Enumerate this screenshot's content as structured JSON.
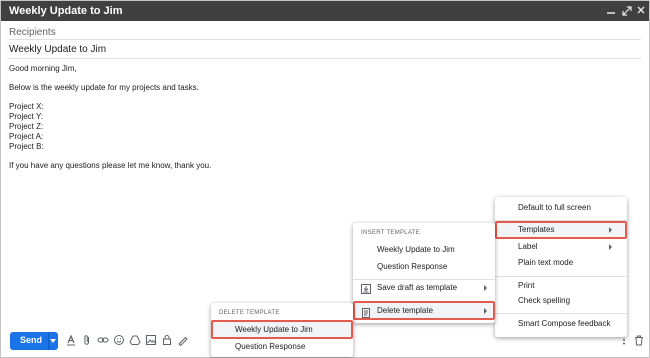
{
  "window": {
    "title": "Weekly Update to Jim",
    "controls": [
      "minimize-icon",
      "expand-icon",
      "close-icon"
    ]
  },
  "compose": {
    "recipients_placeholder": "Recipients",
    "subject": "Weekly Update to Jim",
    "body_lines": [
      "Good morning Jim,",
      "Below is the weekly update for my projects and tasks.",
      "Project X:",
      "Project Y:",
      "Project Z:",
      "Project A:",
      "Project B:",
      "If you have any questions please let me know, thank you."
    ]
  },
  "toolbar": {
    "send_label": "Send",
    "icons": [
      "formatting-icon",
      "attach-icon",
      "link-icon",
      "emoji-icon",
      "drive-icon",
      "photo-icon",
      "confidential-icon",
      "signature-icon"
    ],
    "right_icons": [
      "more-options-icon",
      "trash-icon"
    ]
  },
  "more_menu": {
    "items": [
      {
        "label": "Default to full screen"
      },
      {
        "label": "Templates",
        "has_submenu": true,
        "highlighted": true
      },
      {
        "label": "Label",
        "has_submenu": true
      },
      {
        "label": "Plain text mode"
      },
      {
        "label": "Print"
      },
      {
        "label": "Check spelling"
      },
      {
        "label": "Smart Compose feedback"
      }
    ]
  },
  "templates_menu": {
    "insert_header": "INSERT TEMPLATE",
    "insert_items": [
      "Weekly Update to Jim",
      "Question Response"
    ],
    "save_label": "Save draft as template",
    "delete_label": "Delete template"
  },
  "delete_menu": {
    "header": "DELETE TEMPLATE",
    "items": [
      "Weekly Update to Jim",
      "Question Response"
    ]
  },
  "colors": {
    "titlebar": "#404040",
    "send": "#1a73e8",
    "highlight_border": "#e35a4f"
  }
}
